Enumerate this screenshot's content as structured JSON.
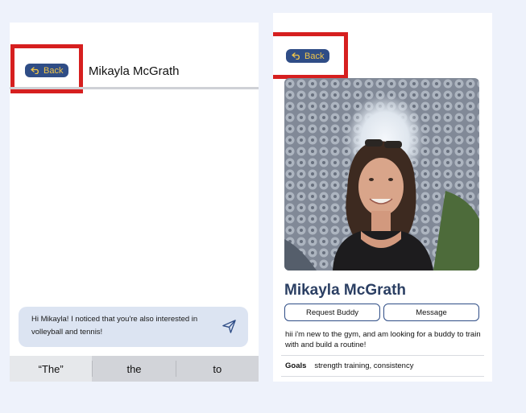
{
  "chat_screen": {
    "back_label": "Back",
    "title": "Mikayla McGrath",
    "message_text": "Hi Mikayla! I noticed that you're also interested in volleyball and tennis!",
    "keyboard_suggestions": [
      "“The”",
      "the",
      "to"
    ],
    "icons": {
      "back": "back-arrow-icon",
      "send": "send-icon"
    }
  },
  "profile_screen": {
    "back_label": "Back",
    "name": "Mikayla McGrath",
    "request_buddy_label": "Request Buddy",
    "message_label": "Message",
    "bio": "hii i'm new to the gym, and am looking for a buddy to train with and build a routine!",
    "goals_label": "Goals",
    "goals_value": "strength training, consistency"
  },
  "colors": {
    "background": "#eef2fb",
    "accent_blue": "#2f4d86",
    "back_text": "#f0c54a",
    "highlight_red": "#d61f1f",
    "bubble": "#dce4f2",
    "name_text": "#2b3f63"
  }
}
